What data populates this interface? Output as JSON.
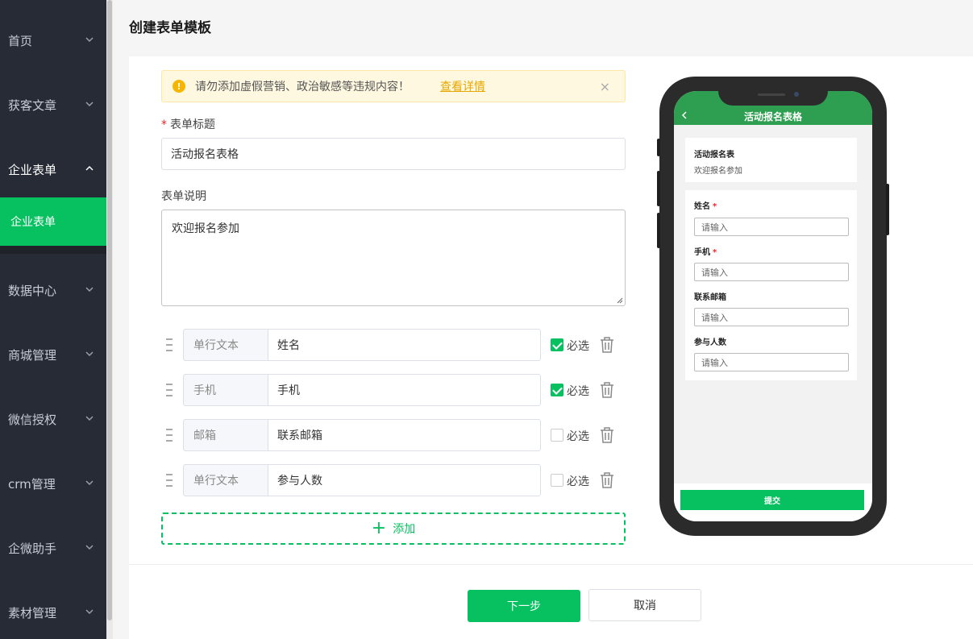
{
  "sidebar": {
    "items": [
      {
        "label": "首页"
      },
      {
        "label": "获客文章"
      },
      {
        "label": "企业表单"
      },
      {
        "label": "数据中心"
      },
      {
        "label": "商城管理"
      },
      {
        "label": "微信授权"
      },
      {
        "label": "crm管理"
      },
      {
        "label": "企微助手"
      },
      {
        "label": "素材管理"
      }
    ],
    "sub_item": "企业表单"
  },
  "page": {
    "title": "创建表单模板"
  },
  "alert": {
    "text": "请勿添加虚假营销、政治敏感等违规内容！",
    "link": "查看详情",
    "close": "×"
  },
  "form": {
    "title_label": "表单标题",
    "title_value": "活动报名表格",
    "desc_label": "表单说明",
    "desc_value": "欢迎报名参加",
    "required_label": "必选",
    "fields": [
      {
        "type": "单行文本",
        "name": "姓名",
        "required": true
      },
      {
        "type": "手机",
        "name": "手机",
        "required": true
      },
      {
        "type": "邮箱",
        "name": "联系邮箱",
        "required": false
      },
      {
        "type": "单行文本",
        "name": "参与人数",
        "required": false
      }
    ],
    "add_label": "添加"
  },
  "footer": {
    "next": "下一步",
    "cancel": "取消"
  },
  "preview": {
    "header_title": "活动报名表格",
    "card_title": "活动报名表",
    "card_desc": "欢迎报名参加",
    "fields": [
      {
        "label": "姓名",
        "placeholder": "请输入",
        "required": true
      },
      {
        "label": "手机",
        "placeholder": "请输入",
        "required": true
      },
      {
        "label": "联系邮箱",
        "placeholder": "请输入",
        "required": false
      },
      {
        "label": "参与人数",
        "placeholder": "请输入",
        "required": false
      }
    ],
    "submit": "提交",
    "required_mark": "*"
  },
  "colors": {
    "accent": "#07c160",
    "sidebar": "#262b35",
    "phone_header": "#2e9e50",
    "alert_bg": "#fff8e1"
  }
}
